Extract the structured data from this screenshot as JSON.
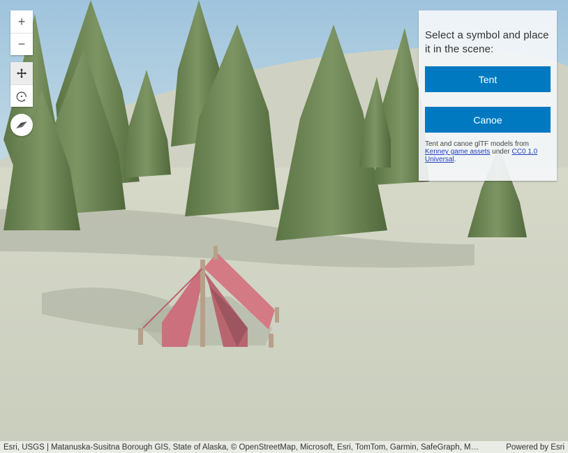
{
  "view": {
    "zoom_in_label": "+",
    "zoom_out_label": "−",
    "navigation_modes": [
      "pan",
      "rotate"
    ],
    "active_mode": "pan"
  },
  "panel": {
    "title": "Select a symbol and place it in the scene:",
    "buttons": [
      {
        "label": "Tent"
      },
      {
        "label": "Canoe"
      }
    ],
    "credits": {
      "prefix": "Tent and canoe glTF models from ",
      "link1": "Kenney game assets",
      "middle": " under ",
      "link2": "CC0 1.0 Universal",
      "suffix": "."
    }
  },
  "attribution": {
    "text": "Esri, USGS | Matanuska-Susitna Borough GIS, State of Alaska, © OpenStreetMap, Microsoft, Esri, TomTom, Garmin, SafeGraph, M…",
    "powered_by": "Powered by Esri"
  },
  "colors": {
    "accent": "#0079c1",
    "sky": "#a9cbe0",
    "ground": "#d2d6c6",
    "tree": "#6b8551",
    "tent": "#d47a84"
  }
}
